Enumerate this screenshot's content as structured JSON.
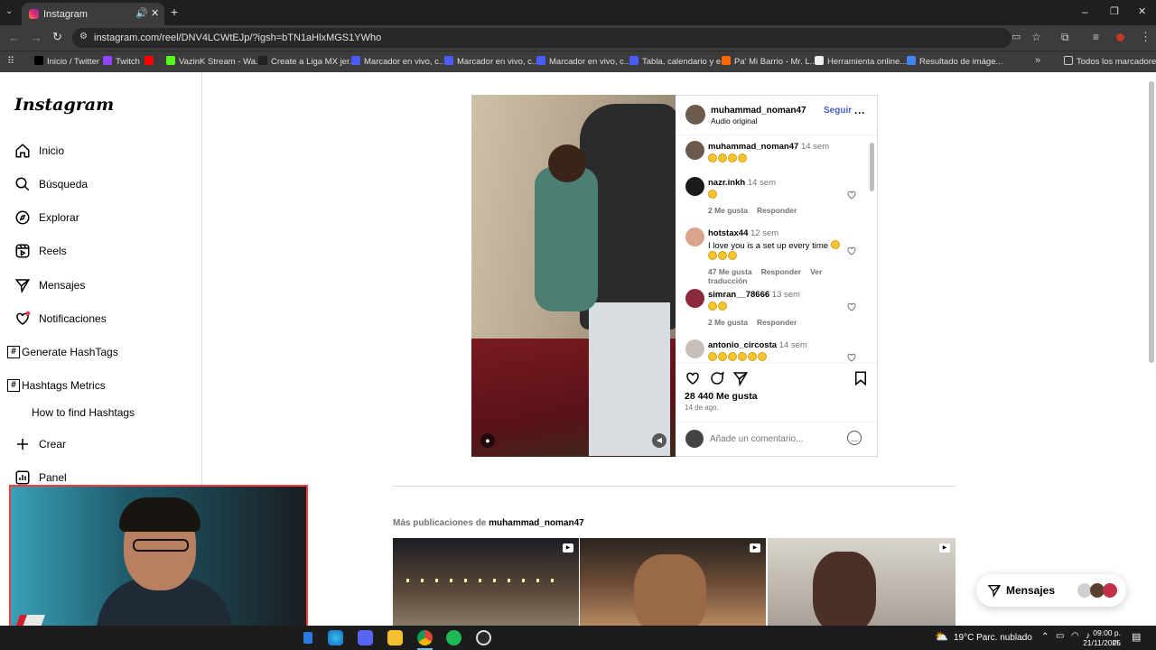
{
  "browser": {
    "tab_title": "Instagram",
    "url": "instagram.com/reel/DNV4LCWtEJp/?igsh=bTN1aHlxMGS1YWho",
    "bookmarks": [
      {
        "label": "Inicio / Twitter",
        "color": "#000000"
      },
      {
        "label": "Twitch",
        "color": "#9146ff"
      },
      {
        "label": "",
        "color": "#ff0000"
      },
      {
        "label": "VazinK Stream - Wa...",
        "color": "#53fc18"
      },
      {
        "label": "Create a Liga MX jer...",
        "color": "#222222"
      },
      {
        "label": "Marcador en vivo, c...",
        "color": "#4a5cff"
      },
      {
        "label": "Marcador en vivo, c...",
        "color": "#4a5cff"
      },
      {
        "label": "Marcador en vivo, c...",
        "color": "#4a5cff"
      },
      {
        "label": "Tabla, calendario y e...",
        "color": "#4a5cff"
      },
      {
        "label": "Pa' Mi Barrio - Mr. L...",
        "color": "#ff6a00"
      },
      {
        "label": "Herramienta online...",
        "color": "#eeeeee"
      },
      {
        "label": "Resultado de imáge...",
        "color": "#4285f4"
      }
    ],
    "all_bookmarks": "Todos los marcadores"
  },
  "sidebar": {
    "logo": "Instagram",
    "items": [
      {
        "label": "Inicio",
        "icon": "home-icon"
      },
      {
        "label": "Búsqueda",
        "icon": "search-icon"
      },
      {
        "label": "Explorar",
        "icon": "compass-icon"
      },
      {
        "label": "Reels",
        "icon": "reels-icon"
      },
      {
        "label": "Mensajes",
        "icon": "send-icon"
      },
      {
        "label": "Notificaciones",
        "icon": "heart-icon"
      }
    ],
    "ext_items": [
      "Generate HashTags",
      "Hashtags Metrics"
    ],
    "how_to": "How to find Hashtags",
    "create": "Crear",
    "panel": "Panel"
  },
  "post": {
    "author": "muhammad_noman47",
    "follow": "Seguir",
    "audio": "Audio original",
    "caption_user": "muhammad_noman47",
    "caption_time": "14 sem",
    "comments": [
      {
        "user": "nazr.inkh",
        "time": "14 sem",
        "text": "",
        "emoji": 1,
        "likes": "2 Me gusta",
        "reply": "Responder",
        "translate": ""
      },
      {
        "user": "hotstax44",
        "time": "12 sem",
        "text": "I love you is a set up every time",
        "emoji": 4,
        "likes": "47 Me gusta",
        "reply": "Responder",
        "translate": "Ver traducción"
      },
      {
        "user": "simran__78666",
        "time": "13 sem",
        "text": "",
        "emoji": 2,
        "likes": "2 Me gusta",
        "reply": "Responder",
        "translate": ""
      },
      {
        "user": "antonio_circosta",
        "time": "14 sem",
        "text": "",
        "emoji": 6,
        "likes": "",
        "reply": "",
        "translate": ""
      }
    ],
    "likes": "28 440 Me gusta",
    "date": "14 de ago.",
    "comment_placeholder": "Añade un comentario..."
  },
  "more_posts": {
    "prefix": "Más publicaciones de",
    "user": "muhammad_noman47"
  },
  "messages_button": "Mensajes",
  "taskbar": {
    "weather": "19°C  Parc. nublado",
    "time": "09:00 p. m.",
    "date": "21/11/2025"
  }
}
